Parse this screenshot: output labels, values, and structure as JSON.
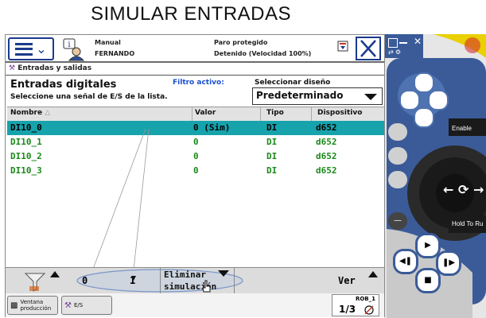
{
  "title": "SIMULAR ENTRADAS",
  "header": {
    "mode": "Manual",
    "user": "FERNANDO",
    "state": "Paro protegido",
    "speed": "Detenido (Velocidad 100%)"
  },
  "breadcrumb": "Entradas y salidas",
  "main": {
    "heading": "Entradas digitales",
    "subheading": "Seleccione una señal de E/S de la lista.",
    "filter_label": "Filtro activo:",
    "layout_label": "Seleccionar diseño",
    "layout_value": "Predeterminado"
  },
  "table": {
    "columns": [
      "Nombre",
      "Valor",
      "Tipo",
      "Dispositivo"
    ],
    "rows": [
      [
        "DI10_0",
        "0 (Sim)",
        "DI",
        "d652"
      ],
      [
        "DI10_1",
        "0",
        "DI",
        "d652"
      ],
      [
        "DI10_2",
        "0",
        "DI",
        "d652"
      ],
      [
        "DI10_3",
        "0",
        "DI",
        "d652"
      ]
    ],
    "selected_row": 0
  },
  "bottom": {
    "btn0": "0",
    "btn1": "1",
    "remove_sim": "Eliminar simulación",
    "view": "Ver"
  },
  "taskbar": {
    "production": "Ventana producción",
    "io": "E/S",
    "robot": "ROB_1",
    "fraction": "1/3"
  },
  "panel": {
    "enable": "Enable",
    "hold": "Hold To Ru"
  },
  "colors": {
    "selected_row": "#16a3ac",
    "signal_text": "#1a8a1a",
    "accent": "#1a3a8c",
    "panel_blue": "#3d5fa0"
  }
}
